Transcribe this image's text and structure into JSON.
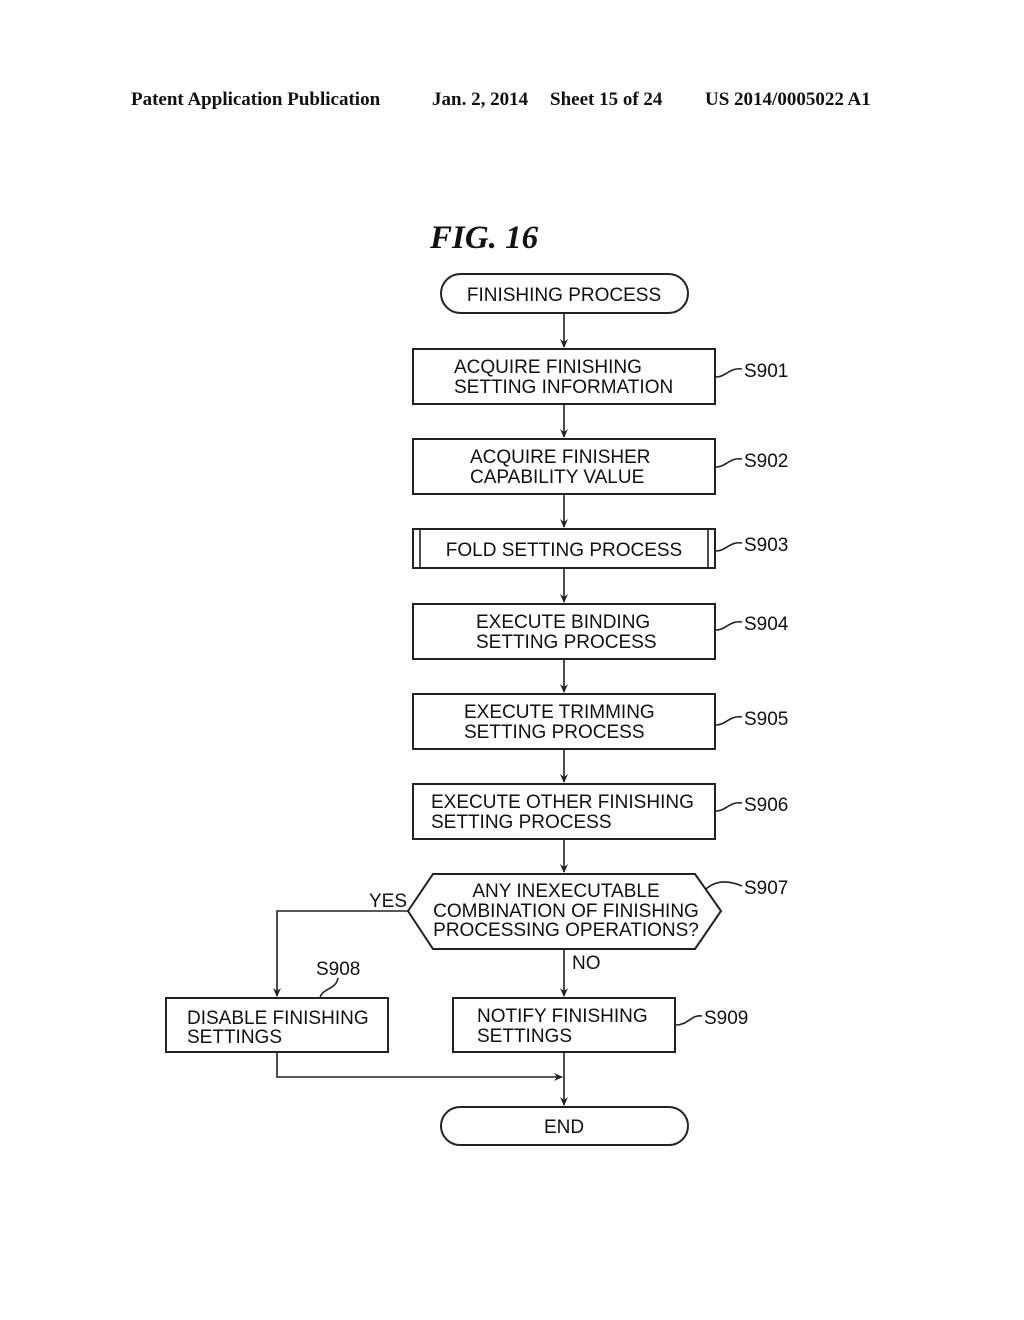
{
  "header": {
    "publication": "Patent Application Publication",
    "date": "Jan. 2, 2014",
    "sheet": "Sheet 15 of 24",
    "number": "US 2014/0005022 A1"
  },
  "figure": {
    "title": "FIG. 16",
    "start": "FINISHING PROCESS",
    "end": "END",
    "steps": [
      {
        "id": "S901",
        "lines": [
          "ACQUIRE FINISHING",
          "SETTING INFORMATION"
        ]
      },
      {
        "id": "S902",
        "lines": [
          "ACQUIRE FINISHER",
          "CAPABILITY VALUE"
        ]
      },
      {
        "id": "S903",
        "lines": [
          "FOLD SETTING PROCESS"
        ]
      },
      {
        "id": "S904",
        "lines": [
          "EXECUTE BINDING",
          "SETTING PROCESS"
        ]
      },
      {
        "id": "S905",
        "lines": [
          "EXECUTE TRIMMING",
          "SETTING PROCESS"
        ]
      },
      {
        "id": "S906",
        "lines": [
          "EXECUTE OTHER FINISHING",
          "SETTING PROCESS"
        ]
      }
    ],
    "decision": {
      "id": "S907",
      "lines": [
        "ANY INEXECUTABLE",
        "COMBINATION OF FINISHING",
        "PROCESSING OPERATIONS?"
      ],
      "yes_label": "YES",
      "no_label": "NO"
    },
    "yes_step": {
      "id": "S908",
      "lines": [
        "DISABLE FINISHING",
        "SETTINGS"
      ]
    },
    "no_step": {
      "id": "S909",
      "lines": [
        "NOTIFY FINISHING",
        "SETTINGS"
      ]
    }
  }
}
